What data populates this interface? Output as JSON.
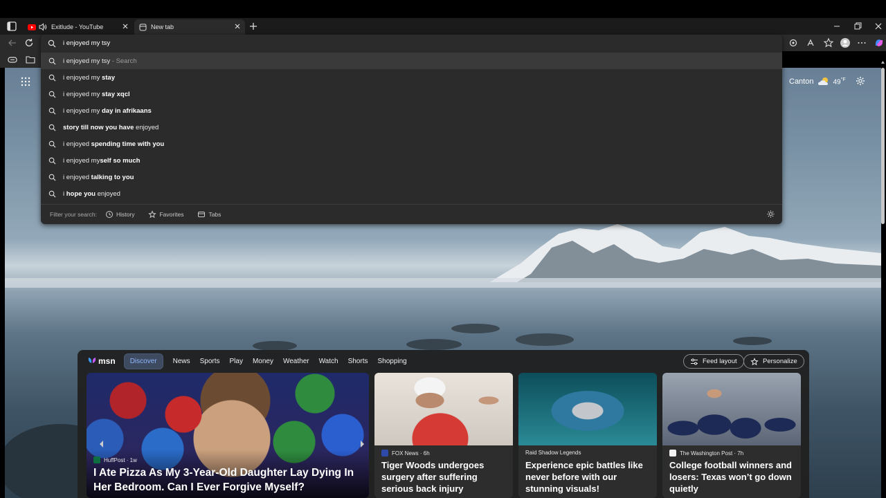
{
  "tabs": [
    {
      "title": "Exitlude - YouTube",
      "favicon": "youtube-icon",
      "audio": "speaker-icon"
    },
    {
      "title": "New tab",
      "favicon": "newtab-icon"
    }
  ],
  "omnibox": {
    "query": "i enjoyed my tsy",
    "suggestions": [
      {
        "prefix": "i enjoyed my tsy",
        "bold": "",
        "hint": " - Search"
      },
      {
        "prefix": "i enjoyed my ",
        "bold": "stay",
        "hint": ""
      },
      {
        "prefix": "i enjoyed my ",
        "bold": "stay xqcl",
        "hint": ""
      },
      {
        "prefix": "i enjoyed my ",
        "bold": "day in afrikaans",
        "hint": ""
      },
      {
        "prefix": "",
        "bold": "story till now you have",
        "suffix": " enjoyed",
        "hint": ""
      },
      {
        "prefix": "i enjoyed ",
        "bold": "spending time with you",
        "hint": ""
      },
      {
        "prefix": "i enjoyed my",
        "bold": "self so much",
        "hint": ""
      },
      {
        "prefix": "i enjoyed ",
        "bold": "talking to you",
        "hint": ""
      },
      {
        "prefix": "i ",
        "bold": "hope you",
        "suffix": " enjoyed",
        "hint": ""
      }
    ],
    "filter_label": "Filter your search:",
    "filters": [
      "History",
      "Favorites",
      "Tabs"
    ]
  },
  "weather": {
    "city": "Canton",
    "temp": "49",
    "unit": "°F",
    "icon": "partly-cloudy-icon"
  },
  "msn": {
    "logo": "msn",
    "tabs": [
      "Discover",
      "News",
      "Sports",
      "Play",
      "Money",
      "Weather",
      "Watch",
      "Shorts",
      "Shopping"
    ],
    "feed_layout": "Feed layout",
    "personalize": "Personalize",
    "cards": [
      {
        "source": "HuffPost · 1w",
        "headline": "I Ate Pizza As My 3-Year-Old Daughter Lay Dying In Her Bedroom. Can I Ever Forgive Myself?"
      },
      {
        "source": "FOX News · 6h",
        "headline": "Tiger Woods undergoes surgery after suffering serious back injury"
      },
      {
        "source": "Raid Shadow Legends",
        "headline": "Experience epic battles like never before with our stunning visuals!"
      },
      {
        "source": "The Washington Post · 7h",
        "headline": "College football winners and losers: Texas won’t go down quietly"
      }
    ]
  },
  "colors": {
    "accent": "#8fb6ff",
    "omnibox_bg": "#2b2b2b",
    "youtube_red": "#ff0000"
  }
}
